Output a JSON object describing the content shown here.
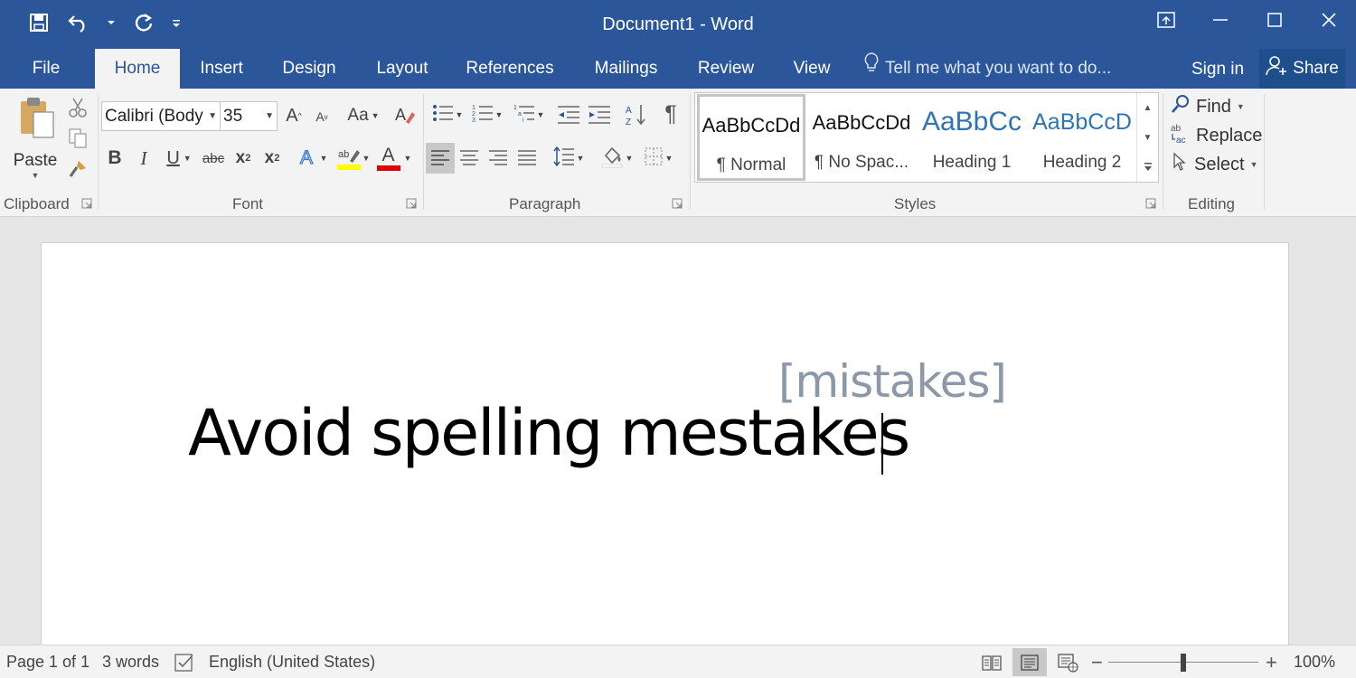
{
  "window": {
    "title": "Document1 - Word"
  },
  "quick_access": {
    "icons": [
      "save-icon",
      "undo-icon",
      "redo-icon",
      "customize-icon"
    ]
  },
  "window_controls": {
    "icons": [
      "ribbon-display-icon",
      "minimize-icon",
      "maximize-icon",
      "close-icon"
    ]
  },
  "tabs": [
    {
      "label": "File"
    },
    {
      "label": "Home",
      "active": true
    },
    {
      "label": "Insert"
    },
    {
      "label": "Design"
    },
    {
      "label": "Layout"
    },
    {
      "label": "References"
    },
    {
      "label": "Mailings"
    },
    {
      "label": "Review"
    },
    {
      "label": "View"
    }
  ],
  "tell_me": {
    "placeholder": "Tell me what you want to do..."
  },
  "account": {
    "sign_in": "Sign in",
    "share": "Share"
  },
  "ribbon": {
    "clipboard": {
      "label": "Clipboard",
      "paste": "Paste"
    },
    "font": {
      "label": "Font",
      "family": "Calibri (Body",
      "size": "35",
      "change_case": "Aa",
      "bold": "B",
      "italic": "I",
      "underline": "U",
      "strikethrough": "abc",
      "subscript": "x",
      "superscript": "x",
      "highlight_color": "#ffff00",
      "font_color": "#e00000"
    },
    "paragraph": {
      "label": "Paragraph",
      "show_marks": "¶"
    },
    "styles": {
      "label": "Styles",
      "items": [
        {
          "preview": "AaBbCcDd",
          "name": "¶ Normal",
          "selected": true,
          "color": "#111111"
        },
        {
          "preview": "AaBbCcDd",
          "name": "¶ No Spac...",
          "selected": false,
          "color": "#111111"
        },
        {
          "preview": "AaBbCc",
          "name": "Heading 1",
          "selected": false,
          "color": "#2e74b5"
        },
        {
          "preview": "AaBbCcD",
          "name": "Heading 2",
          "selected": false,
          "color": "#2e74b5"
        }
      ]
    },
    "editing": {
      "label": "Editing",
      "find": "Find",
      "replace": "Replace",
      "select": "Select"
    }
  },
  "document": {
    "body_text": "Avoid spelling mestakes",
    "annotation": "[mistakes]"
  },
  "status": {
    "page": "Page 1 of 1",
    "words": "3 words",
    "language": "English (United States)",
    "zoom": "100%",
    "zoom_level": 0.5
  },
  "colors": {
    "accent": "#2b579a",
    "ribbon_bg": "#f3f3f3"
  }
}
